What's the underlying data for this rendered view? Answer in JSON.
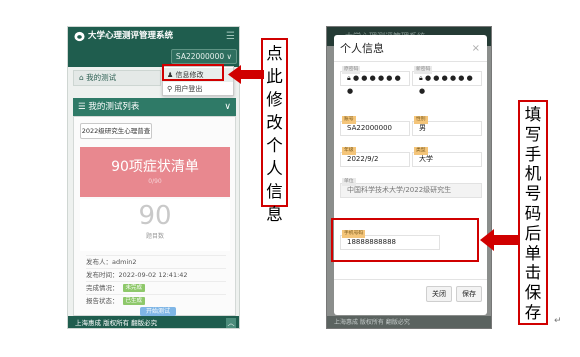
{
  "left_phone": {
    "app_title": "大学心理测评管理系统",
    "menu_icon": "hamburger-icon",
    "user_button": "SA22000000 ∨",
    "dropdown": {
      "edit_info": "信息修改",
      "logout": "用户登出"
    },
    "my_tests": "我的测试",
    "list_header": "我的测试列表",
    "tab_label": "2022级研究生心理普查",
    "card_title": "90项症状清单",
    "card_sub": "0/90",
    "score": "90",
    "score_label": "题目数",
    "rows": {
      "publisher": "发布人：admin2",
      "time": "发布时间：2022-09-02 12:41:42",
      "status_label": "完成情况：",
      "status_value": "未完成",
      "report_label": "报告状态：",
      "report_value": "已生成"
    },
    "start_button": "开始测试",
    "footer": "上海惠成 版权所有 翻版必究"
  },
  "annotations": {
    "left_text": [
      "点",
      "此",
      "修",
      "改",
      "个",
      "人",
      "信",
      "息"
    ],
    "right_text": [
      "填",
      "写",
      "手",
      "机",
      "号",
      "码",
      "后",
      "单",
      "击",
      "保",
      "存"
    ],
    "accent_color": "#d00000"
  },
  "right_phone": {
    "header": "大学心理测评管理系统",
    "modal_title": "个人信息",
    "password_tag": "原密码",
    "password_value": "● ● ● ● ● ● ●",
    "new_password_tag": "新密码",
    "new_password_value": "● ● ● ● ● ● ●",
    "username_tag": "账号",
    "username": "SA22000000",
    "gender_tag": "性别",
    "gender": "男",
    "grade_tag": "年级",
    "grade": "2022/9/2",
    "type_tag": "类型",
    "type": "大学",
    "school_tag": "单位",
    "school": "中国科学技术大学/2022级研究生",
    "phone_tag": "手机号码",
    "phone": "18888888888",
    "close_button": "关闭",
    "save_button": "保存",
    "footer": "上海惠成 版权所有 翻版必究"
  }
}
